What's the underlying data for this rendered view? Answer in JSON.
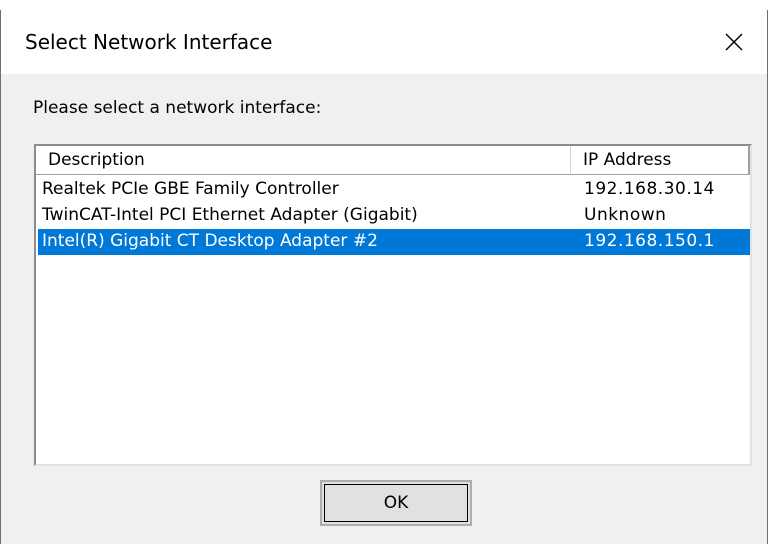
{
  "window": {
    "title": "Select Network Interface",
    "close_icon": "close-icon"
  },
  "prompt": "Please select a network interface:",
  "list": {
    "columns": [
      "Description",
      "IP Address"
    ],
    "rows": [
      {
        "description": "Realtek PCIe GBE Family Controller",
        "ip": "192.168.30.14",
        "selected": false
      },
      {
        "description": "TwinCAT-Intel PCI Ethernet Adapter (Gigabit)",
        "ip": "Unknown",
        "selected": false
      },
      {
        "description": "Intel(R) Gigabit CT Desktop Adapter #2",
        "ip": "192.168.150.1",
        "selected": true
      }
    ],
    "selection_color": "#0078d7"
  },
  "buttons": {
    "ok_label": "OK"
  }
}
